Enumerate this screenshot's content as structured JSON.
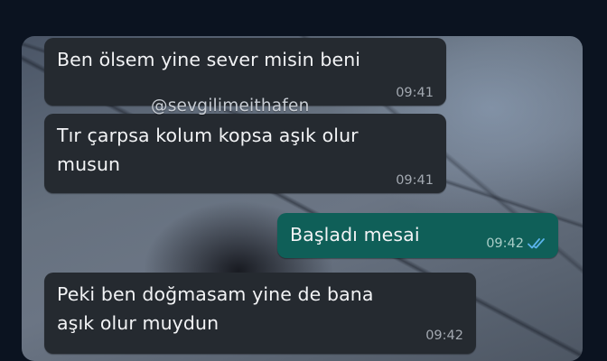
{
  "messages": [
    {
      "text": "Ben ölsem yine sever misin beni",
      "time": "09:41",
      "direction": "incoming"
    },
    {
      "text": "Tır çarpsa kolum kopsa aşık olur\nmusun",
      "time": "09:41",
      "direction": "incoming"
    },
    {
      "text": "Başladı mesai",
      "time": "09:42",
      "direction": "outgoing",
      "status": "read",
      "status_icon": "double-check-icon"
    },
    {
      "text": "Peki ben doğmasam yine de bana\naşık olur muydun",
      "time": "09:42",
      "direction": "incoming"
    }
  ],
  "watermark": "@sevgilimeithafen",
  "colors": {
    "incoming_bubble": "#252a30",
    "outgoing_bubble": "#0f5f58",
    "read_ticks": "#5ab3ea",
    "page_background": "#0b1320"
  }
}
